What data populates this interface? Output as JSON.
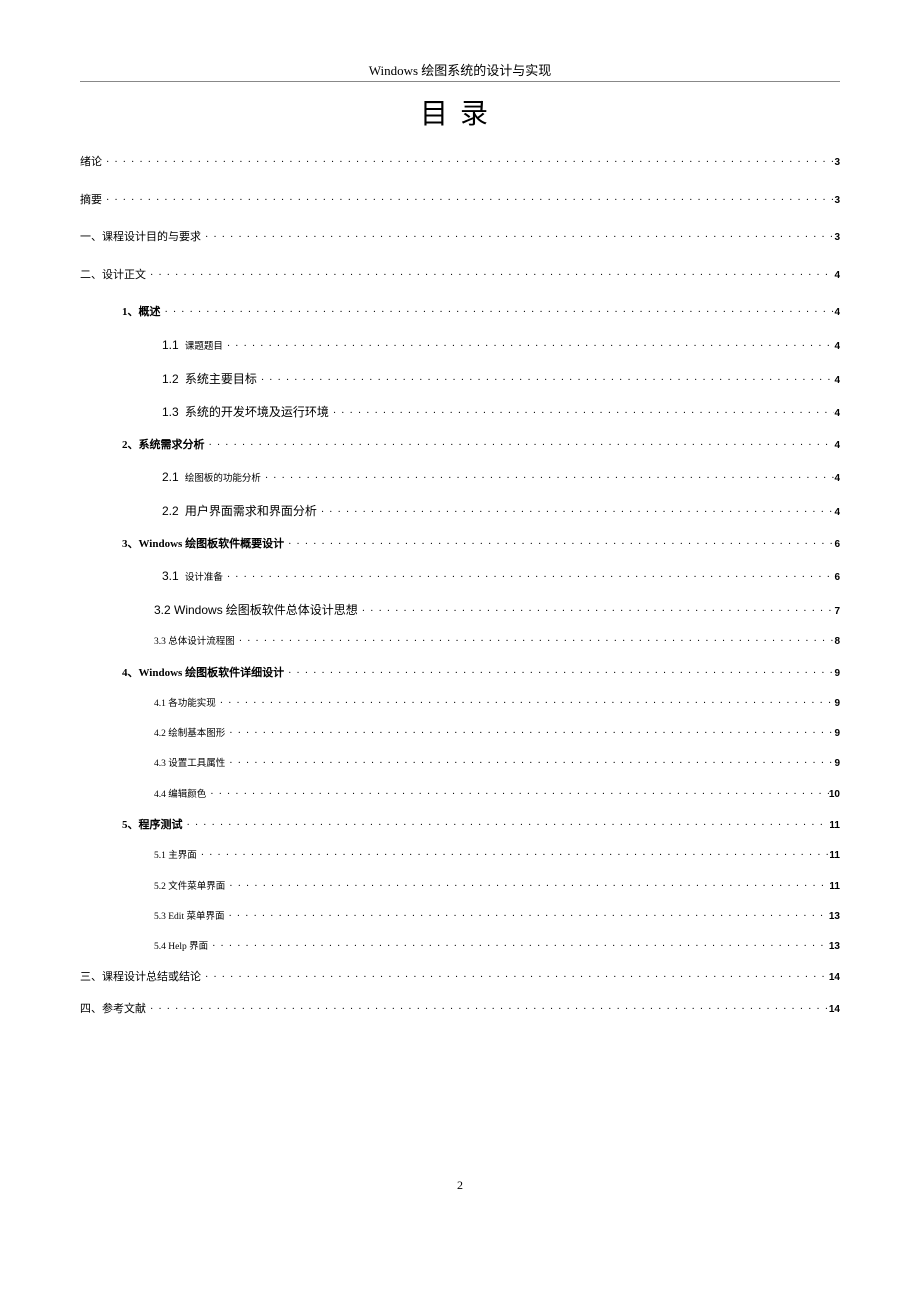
{
  "header": "Windows 绘图系统的设计与实现",
  "title": "目录",
  "footer_page": "2",
  "entries": [
    {
      "indent": "lvl0",
      "labelClass": "cn",
      "gap": "",
      "label": "绪论",
      "page": "3"
    },
    {
      "indent": "lvl0",
      "labelClass": "cn",
      "gap": "",
      "label": "摘要",
      "page": "3"
    },
    {
      "indent": "lvl0",
      "labelClass": "cn",
      "gap": "",
      "label": "一、课程设计目的与要求",
      "page": "3"
    },
    {
      "indent": "lvl0",
      "labelClass": "cn",
      "gap": "",
      "label": "二、设计正文",
      "page": "4"
    },
    {
      "indent": "lvl1",
      "labelClass": "cn bold",
      "gap": "small-gap",
      "label": "1、概述",
      "page": "4"
    },
    {
      "indent": "lvl2",
      "labelClass": "",
      "gap": "small-gap",
      "label": "<span class='num'>1.1</span>&nbsp;&nbsp;<span class='small cn'>课题题目</span>",
      "page": "4"
    },
    {
      "indent": "lvl2",
      "labelClass": "",
      "gap": "small-gap",
      "label": "<span class='num'>1.2</span>&nbsp;&nbsp;<span class='mid cn'>系统主要目标</span>",
      "page": "4"
    },
    {
      "indent": "lvl2",
      "labelClass": "",
      "gap": "small-gap",
      "label": "<span class='num'>1.3</span>&nbsp;&nbsp;<span class='mid cn'>系统的开发坏境及运行环境</span>",
      "page": "4"
    },
    {
      "indent": "lvl1",
      "labelClass": "cn bold",
      "gap": "small-gap",
      "label": "2、系统需求分析",
      "page": "4"
    },
    {
      "indent": "lvl2",
      "labelClass": "",
      "gap": "small-gap",
      "label": "<span class='num'>2.1</span>&nbsp;&nbsp;<span class='small cn'>绘图板的功能分析</span>",
      "page": "4"
    },
    {
      "indent": "lvl2",
      "labelClass": "",
      "gap": "small-gap",
      "label": "<span class='num'>2.2</span>&nbsp;&nbsp;<span class='mid cn'>用户界面需求和界面分析</span>",
      "page": "4"
    },
    {
      "indent": "lvl1",
      "labelClass": "cn bold",
      "gap": "small-gap",
      "label": "3、Windows 绘图板软件概要设计",
      "page": "6"
    },
    {
      "indent": "lvl2",
      "labelClass": "",
      "gap": "small-gap",
      "label": "<span class='num'>3.1</span>&nbsp;&nbsp;<span class='small cn'>设计准备</span>",
      "page": "6"
    },
    {
      "indent": "lvl2b",
      "labelClass": "",
      "gap": "small-gap",
      "label": "<span class='num mid'>3.2 Windows</span> <span class='mid cn'>绘图板软件总体设计思想</span>",
      "page": "7"
    },
    {
      "indent": "lvl2b",
      "labelClass": "small cn",
      "gap": "small-gap",
      "label": "3.3 总体设计流程图",
      "page": "8"
    },
    {
      "indent": "lvl1",
      "labelClass": "cn bold",
      "gap": "small-gap",
      "label": "4、Windows 绘图板软件详细设计",
      "page": "9"
    },
    {
      "indent": "lvl2b",
      "labelClass": "small cn",
      "gap": "small-gap",
      "label": "4.1 各功能实现",
      "page": "9"
    },
    {
      "indent": "lvl2b",
      "labelClass": "small cn",
      "gap": "small-gap",
      "label": "4.2 绘制基本图形",
      "page": "9"
    },
    {
      "indent": "lvl2b",
      "labelClass": "small cn",
      "gap": "small-gap",
      "label": "4.3 设置工具属性",
      "page": "9"
    },
    {
      "indent": "lvl2b",
      "labelClass": "small cn",
      "gap": "small-gap",
      "label": "4.4 编辑颜色",
      "page": "10"
    },
    {
      "indent": "lvl1",
      "labelClass": "cn bold",
      "gap": "small-gap",
      "label": "5、程序测试",
      "page": "11"
    },
    {
      "indent": "lvl2b",
      "labelClass": "small cn",
      "gap": "small-gap",
      "label": "5.1 主界面",
      "page": "11"
    },
    {
      "indent": "lvl2b",
      "labelClass": "small cn",
      "gap": "small-gap",
      "label": "5.2 文件菜单界面",
      "page": "11"
    },
    {
      "indent": "lvl2b",
      "labelClass": "small cn",
      "gap": "small-gap",
      "label": "5.3 Edit 菜单界面",
      "page": "13"
    },
    {
      "indent": "lvl2b",
      "labelClass": "small cn",
      "gap": "small-gap",
      "label": "5.4 Help 界面",
      "page": "13"
    },
    {
      "indent": "lvl0",
      "labelClass": "cn",
      "gap": "small-gap",
      "label": " 三、课程设计总结或结论",
      "page": "14"
    },
    {
      "indent": "lvl0",
      "labelClass": "cn",
      "gap": "small-gap",
      "label": " 四、参考文献",
      "page": "14"
    }
  ]
}
